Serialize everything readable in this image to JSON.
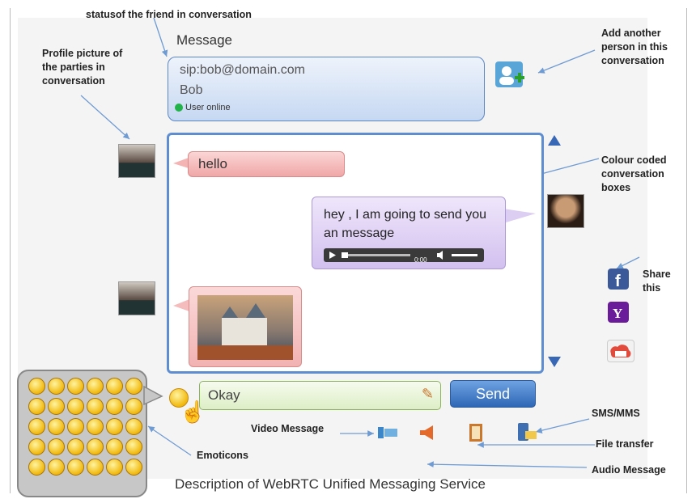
{
  "annotations": {
    "status": "statusof the friend in conversation",
    "profile": [
      "Profile picture of",
      "the parties in",
      "conversation"
    ],
    "add_person": [
      "Add another",
      "person in this",
      "conversation"
    ],
    "colour": [
      "Colour coded",
      "conversation",
      "boxes"
    ],
    "share": [
      "Share",
      "this"
    ],
    "sms": "SMS/MMS",
    "file": "File transfer",
    "audio": "Audio Message",
    "video": "Video Message",
    "emoticons": "Emoticons"
  },
  "header": {
    "title": "Message",
    "sip": "sip:bob@domain.com",
    "name": "Bob",
    "status": "User online"
  },
  "messages": {
    "m1": "hello",
    "m2": "hey , I am going to send you an message",
    "audio_time": "0:00"
  },
  "composer": {
    "value": "Okay",
    "send_label": "Send"
  },
  "caption": "Description of WebRTC Unified Messaging Service",
  "colors": {
    "accent": "#5f8ed0",
    "online": "#21b24a"
  }
}
